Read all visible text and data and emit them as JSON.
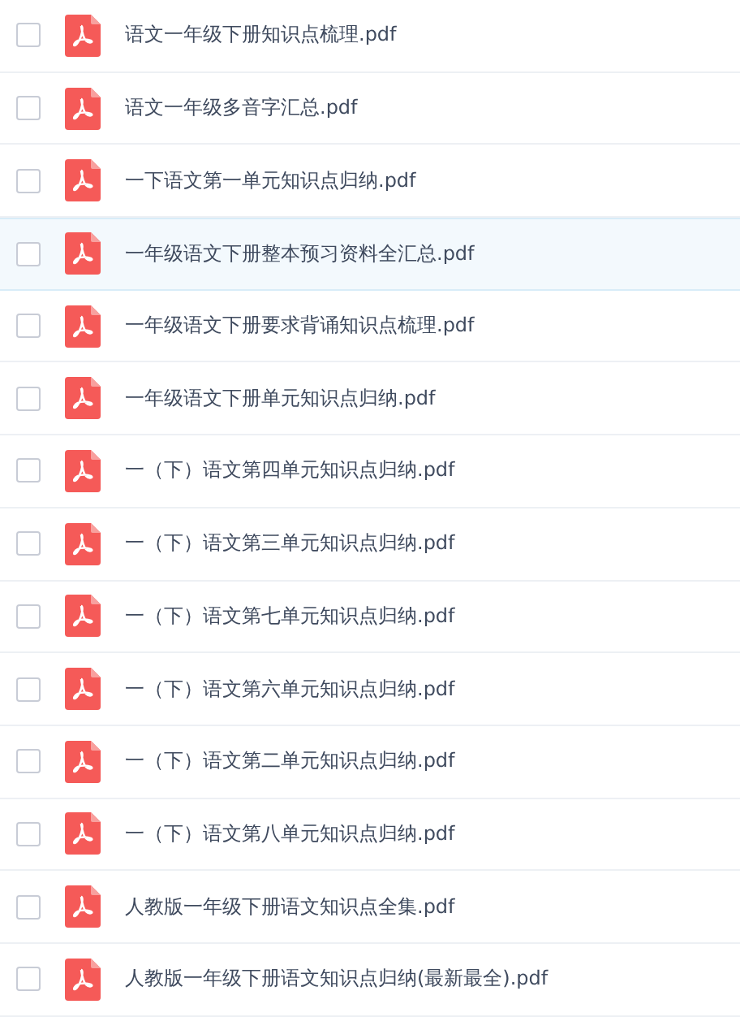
{
  "files": [
    {
      "name": "语文一年级下册知识点梳理.pdf",
      "checked": false,
      "highlighted": false
    },
    {
      "name": "语文一年级多音字汇总.pdf",
      "checked": false,
      "highlighted": false
    },
    {
      "name": "一下语文第一单元知识点归纳.pdf",
      "checked": false,
      "highlighted": false
    },
    {
      "name": "一年级语文下册整本预习资料全汇总.pdf",
      "checked": false,
      "highlighted": true
    },
    {
      "name": "一年级语文下册要求背诵知识点梳理.pdf",
      "checked": false,
      "highlighted": false
    },
    {
      "name": "一年级语文下册单元知识点归纳.pdf",
      "checked": false,
      "highlighted": false
    },
    {
      "name": "一（下）语文第四单元知识点归纳.pdf",
      "checked": false,
      "highlighted": false
    },
    {
      "name": "一（下）语文第三单元知识点归纳.pdf",
      "checked": false,
      "highlighted": false
    },
    {
      "name": "一（下）语文第七单元知识点归纳.pdf",
      "checked": false,
      "highlighted": false
    },
    {
      "name": "一（下）语文第六单元知识点归纳.pdf",
      "checked": false,
      "highlighted": false
    },
    {
      "name": "一（下）语文第二单元知识点归纳.pdf",
      "checked": false,
      "highlighted": false
    },
    {
      "name": "一（下）语文第八单元知识点归纳.pdf",
      "checked": false,
      "highlighted": false
    },
    {
      "name": "人教版一年级下册语文知识点全集.pdf",
      "checked": false,
      "highlighted": false
    },
    {
      "name": "人教版一年级下册语文知识点归纳(最新最全).pdf",
      "checked": false,
      "highlighted": false
    }
  ]
}
